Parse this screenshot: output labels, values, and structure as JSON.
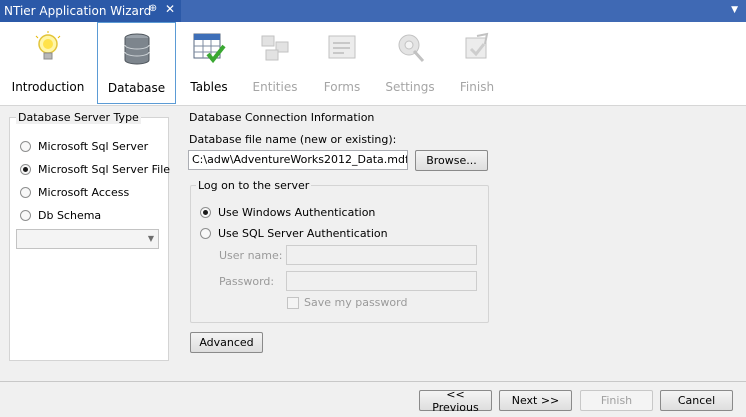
{
  "window": {
    "title": "NTier Application Wizard",
    "pin_glyph": "⊕",
    "close_glyph": "✕",
    "menu_glyph": "▼"
  },
  "steps": [
    {
      "label": "Introduction",
      "icon": "lightbulb-icon",
      "state": "normal"
    },
    {
      "label": "Database",
      "icon": "database-icon",
      "state": "selected"
    },
    {
      "label": "Tables",
      "icon": "table-check-icon",
      "state": "normal"
    },
    {
      "label": "Entities",
      "icon": "entities-icon",
      "state": "disabled"
    },
    {
      "label": "Forms",
      "icon": "forms-icon",
      "state": "disabled"
    },
    {
      "label": "Settings",
      "icon": "settings-icon",
      "state": "disabled"
    },
    {
      "label": "Finish",
      "icon": "finish-icon",
      "state": "disabled"
    }
  ],
  "server_type": {
    "title": "Database Server Type",
    "options": [
      {
        "label": "Microsoft Sql Server",
        "selected": false
      },
      {
        "label": "Microsoft Sql Server File",
        "selected": true
      },
      {
        "label": "Microsoft Access",
        "selected": false
      },
      {
        "label": "Db Schema",
        "selected": false
      }
    ],
    "combo_value": ""
  },
  "connection": {
    "title": "Database Connection Information",
    "file_label": "Database file name (new or existing):",
    "file_value": "C:\\adw\\AdventureWorks2012_Data.mdf",
    "browse_label": "Browse...",
    "logon": {
      "title": "Log on to the server",
      "windows_auth": "Use Windows Authentication",
      "sql_auth": "Use SQL Server Authentication",
      "auth_selected": "windows",
      "username_label": "User name:",
      "password_label": "Password:",
      "username_value": "",
      "password_value": "",
      "save_password_label": "Save my password"
    },
    "advanced_label": "Advanced"
  },
  "footer": {
    "previous_label": "<< Previous",
    "next_label": "Next >>",
    "finish_label": "Finish",
    "cancel_label": "Cancel"
  },
  "colors": {
    "title_bg": "#3f69b4",
    "tab_bg": "#2b59a8",
    "selected_border": "#5b9bd5",
    "disabled_text": "#a5a5a5"
  }
}
